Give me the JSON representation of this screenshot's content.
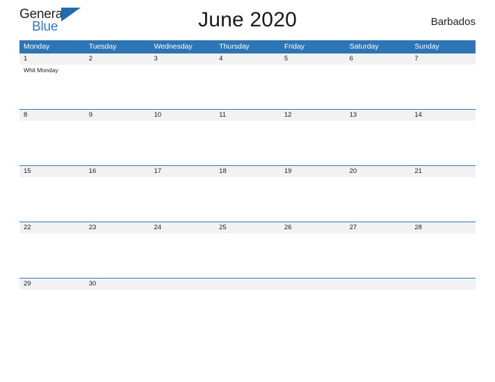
{
  "brand": {
    "name_part1": "General",
    "name_part2": "Blue",
    "flag_icon": "blue-triangle-flag-icon",
    "accent_color": "#2e7bc4"
  },
  "header": {
    "title": "June 2020",
    "locale": "Barbados"
  },
  "theme": {
    "header_blue": "#2e75b6",
    "date_strip_gray": "#f2f2f2",
    "text_dark": "#1a1a1a",
    "background": "#ffffff"
  },
  "calendar": {
    "month": "June",
    "year": "2020",
    "weekday_headers": [
      "Monday",
      "Tuesday",
      "Wednesday",
      "Thursday",
      "Friday",
      "Saturday",
      "Sunday"
    ],
    "weeks": [
      {
        "dates": [
          "1",
          "2",
          "3",
          "4",
          "5",
          "6",
          "7"
        ],
        "events": [
          "Whit Monday",
          "",
          "",
          "",
          "",
          "",
          ""
        ]
      },
      {
        "dates": [
          "8",
          "9",
          "10",
          "11",
          "12",
          "13",
          "14"
        ],
        "events": [
          "",
          "",
          "",
          "",
          "",
          "",
          ""
        ]
      },
      {
        "dates": [
          "15",
          "16",
          "17",
          "18",
          "19",
          "20",
          "21"
        ],
        "events": [
          "",
          "",
          "",
          "",
          "",
          "",
          ""
        ]
      },
      {
        "dates": [
          "22",
          "23",
          "24",
          "25",
          "26",
          "27",
          "28"
        ],
        "events": [
          "",
          "",
          "",
          "",
          "",
          "",
          ""
        ]
      },
      {
        "dates": [
          "29",
          "30",
          "",
          "",
          "",
          "",
          ""
        ],
        "events": [
          "",
          "",
          "",
          "",
          "",
          "",
          ""
        ]
      }
    ]
  }
}
